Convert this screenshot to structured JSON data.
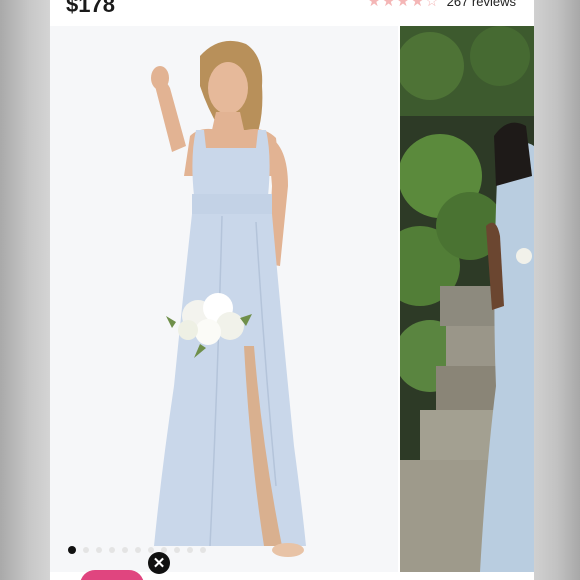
{
  "header": {
    "price": "$178",
    "rating_stars": 4.5,
    "reviews_label": "267 reviews"
  },
  "gallery": {
    "images": [
      {
        "icon": "bridesmaid-gown-photo"
      },
      {
        "icon": "garden-photo"
      }
    ],
    "dot_count": 11,
    "active_index": 0
  },
  "colors": {
    "star": "#f4b6b6",
    "dress": "#c9d7ea",
    "accent_pink": "#e0457f"
  }
}
